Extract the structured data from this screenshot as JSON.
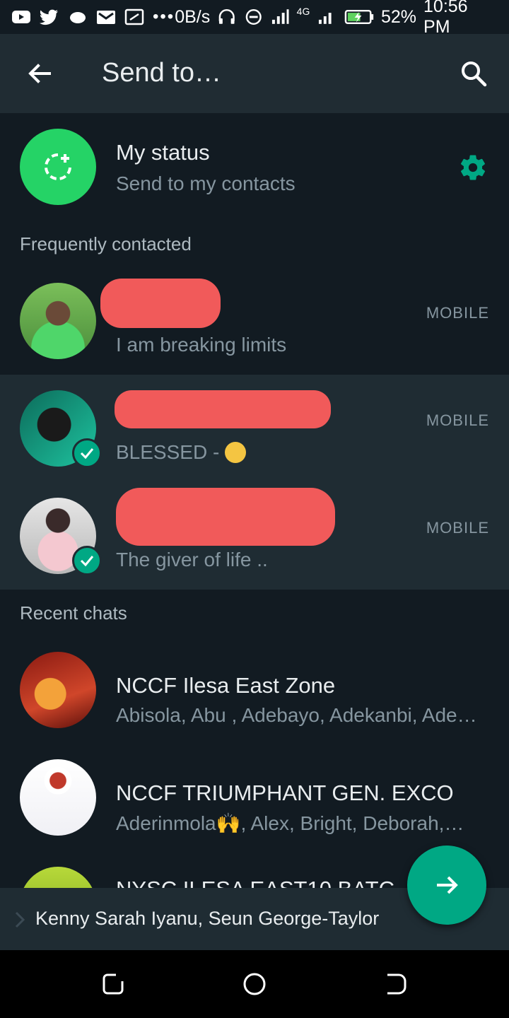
{
  "status_bar": {
    "net_speed": "0B/s",
    "network": "4G",
    "battery": "52%",
    "time": "10:56 PM"
  },
  "appbar": {
    "title": "Send to…"
  },
  "my_status": {
    "name": "My status",
    "subtitle": "Send to my contacts"
  },
  "sections": {
    "frequent": "Frequently contacted",
    "recent": "Recent chats"
  },
  "frequent_contacts": [
    {
      "status": "I am breaking limits",
      "tag": "MOBILE",
      "selected": false
    },
    {
      "status": "BLESSED - ",
      "tag": "MOBILE",
      "selected": true
    },
    {
      "status": "The giver of life ..",
      "tag": "MOBILE",
      "selected": true
    }
  ],
  "recent_chats": [
    {
      "name": "NCCF Ilesa East Zone",
      "members": "Abisola, Abu , Adebayo, Adekanbi, Ade…"
    },
    {
      "name": "NCCF TRIUMPHANT GEN. EXCO",
      "members": "Aderinmola🙌, Alex, Bright, Deborah,…"
    },
    {
      "name": "NYSC ILESA EAST10 BATC",
      "members": ""
    }
  ],
  "selection": {
    "text": "Kenny Sarah Iyanu, Seun George-Taylor"
  },
  "colors": {
    "accent": "#00a884",
    "status_green": "#25d366",
    "background": "#121b22",
    "appbar": "#202c33",
    "redaction": "#f15a5a"
  }
}
